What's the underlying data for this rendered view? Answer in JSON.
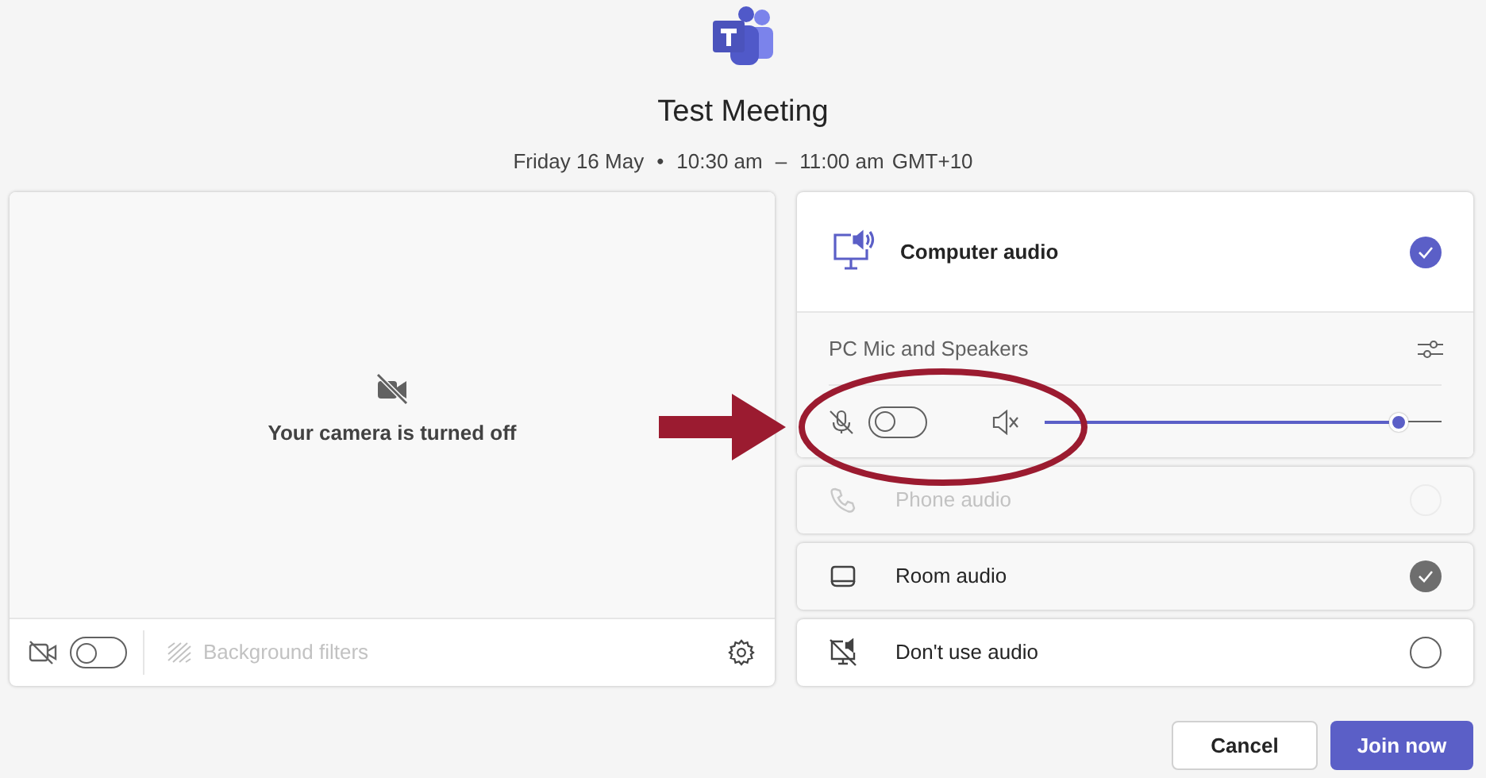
{
  "meeting": {
    "title": "Test Meeting",
    "date": "Friday 16 May",
    "separator": "•",
    "start": "10:30 am",
    "dash": "–",
    "end": "11:00 am",
    "timezone": "GMT+10"
  },
  "camera": {
    "on": false,
    "message": "Your camera is turned off",
    "background_filters": {
      "label": "Background filters",
      "disabled": true
    }
  },
  "audio_options": [
    {
      "kind": "computer",
      "label": "Computer audio",
      "selected": true,
      "connected": false,
      "disabled": false
    },
    {
      "kind": "phone",
      "label": "Phone audio",
      "selected": false,
      "connected": false,
      "disabled": true
    },
    {
      "kind": "room",
      "label": "Room audio",
      "selected": false,
      "connected": true,
      "disabled": false
    },
    {
      "kind": "none",
      "label": "Don't use audio",
      "selected": false,
      "connected": false,
      "disabled": false
    }
  ],
  "device": {
    "name": "PC Mic and Speakers",
    "mic_on": false,
    "speaker_muted": true,
    "level": 0.89
  },
  "buttons": [
    {
      "kind": "secondary",
      "label": "Cancel"
    },
    {
      "kind": "primary",
      "label": "Join now"
    }
  ]
}
